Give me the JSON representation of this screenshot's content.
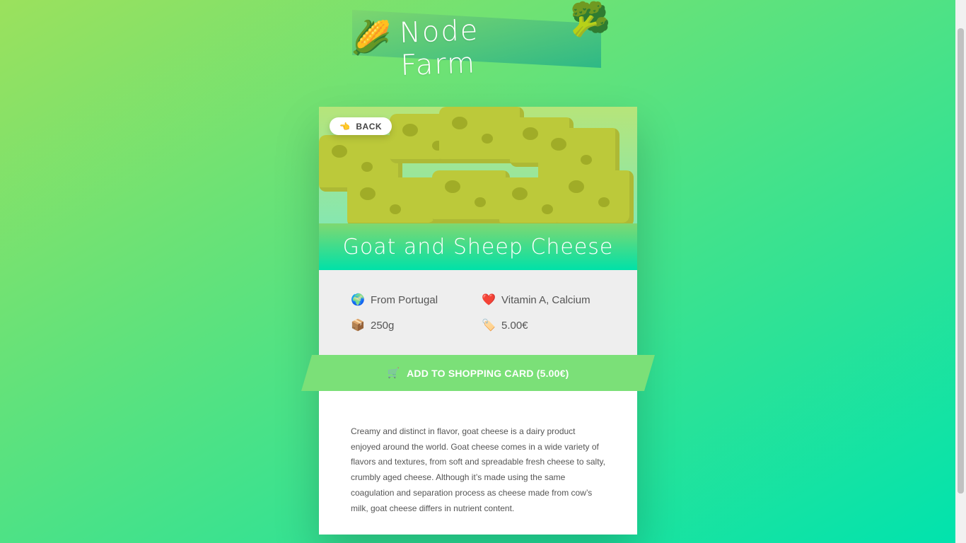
{
  "header": {
    "title": "Node Farm",
    "left_emoji": "🌽",
    "right_emoji": "🥦"
  },
  "product": {
    "back_icon": "👈",
    "back_label": "BACK",
    "name": "Goat and Sheep Cheese",
    "hero_icon": "cheese-image",
    "details": [
      {
        "icon": "🌍",
        "icon_name": "globe-icon",
        "text": "From Portugal"
      },
      {
        "icon": "❤️",
        "icon_name": "heart-icon",
        "text": "Vitamin A, Calcium"
      },
      {
        "icon": "📦",
        "icon_name": "package-icon",
        "text": "250g"
      },
      {
        "icon": "🏷️",
        "icon_name": "price-tag-icon",
        "text": "5.00€"
      }
    ],
    "cart_icon": "🛒",
    "cart_label": "ADD TO SHOPPING CARD (5.00€)",
    "description": "Creamy and distinct in flavor, goat cheese is a dairy product enjoyed around the world. Goat cheese comes in a wide variety of flavors and textures, from soft and spreadable fresh cheese to salty, crumbly aged cheese. Although it’s made using the same coagulation and separation process as cheese made from cow’s milk, goat cheese differs in nutrient content."
  },
  "colors": {
    "background_start": "#9be15d",
    "background_end": "#00e3ae",
    "cart_button": "#7be078"
  }
}
